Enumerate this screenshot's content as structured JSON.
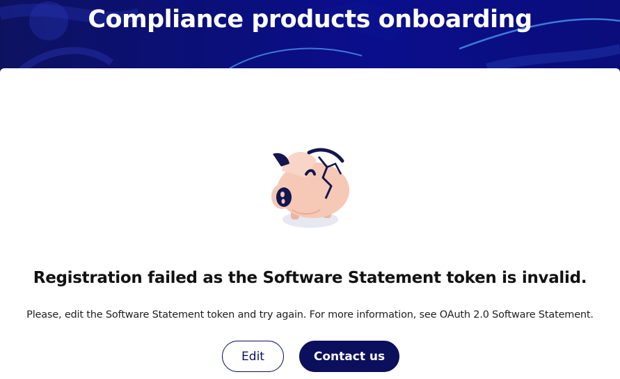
{
  "header": {
    "title": "Compliance products onboarding"
  },
  "error": {
    "illustration": "broken-piggy-bank-icon",
    "title": "Registration failed as the Software Statement token is invalid.",
    "description": "Please, edit the Software Statement token and try again. For more information, see OAuth 2.0 Software Statement."
  },
  "actions": {
    "edit_label": "Edit",
    "contact_label": "Contact us"
  },
  "colors": {
    "header_bg": "#0a0f7a",
    "primary": "#0b0f5c",
    "accent_line": "#3d7bd9",
    "pig_body": "#f5c9b6"
  }
}
